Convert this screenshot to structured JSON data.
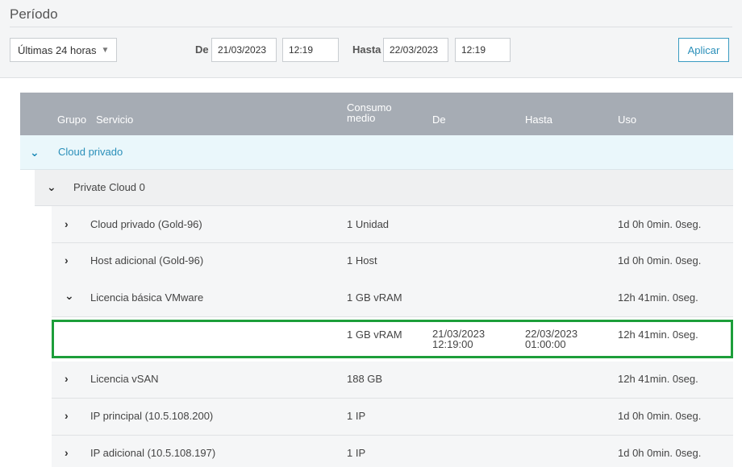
{
  "period": {
    "title": "Período",
    "range_select": "Últimas 24 horas",
    "from_label": "De",
    "from_date": "21/03/2023",
    "from_time": "12:19",
    "to_label": "Hasta",
    "to_date": "22/03/2023",
    "to_time": "12:19",
    "apply_label": "Aplicar"
  },
  "table": {
    "headers": {
      "group": "Grupo",
      "service": "Servicio",
      "consumption_line1": "Consumo",
      "consumption_line2": "medio",
      "from": "De",
      "to": "Hasta",
      "usage": "Uso"
    },
    "group": {
      "label": "Cloud privado"
    },
    "subgroup": {
      "label": "Private Cloud 0"
    },
    "services": [
      {
        "name": "Cloud privado (Gold-96)",
        "consumption": "1 Unidad",
        "usage": "1d 0h 0min. 0seg."
      },
      {
        "name": "Host adicional (Gold-96)",
        "consumption": "1 Host",
        "usage": "1d 0h 0min. 0seg."
      },
      {
        "name": "Licencia básica VMware",
        "consumption": "1 GB vRAM",
        "usage": "12h 41min. 0seg."
      }
    ],
    "detail": {
      "consumption": "1 GB vRAM",
      "from_date": "21/03/2023",
      "from_time": "12:19:00",
      "to_date": "22/03/2023",
      "to_time": "01:00:00",
      "usage": "12h 41min. 0seg."
    },
    "services_after": [
      {
        "name": "Licencia vSAN",
        "consumption": "188 GB",
        "usage": "12h 41min. 0seg."
      },
      {
        "name": "IP principal (10.5.108.200)",
        "consumption": "1 IP",
        "usage": "1d 0h 0min. 0seg."
      },
      {
        "name": "IP adicional (10.5.108.197)",
        "consumption": "1 IP",
        "usage": "1d 0h 0min. 0seg."
      }
    ]
  },
  "colors": {
    "accent": "#2a8fb9",
    "header_bg": "#a6acb4",
    "highlight_border": "#1d9e3a"
  }
}
